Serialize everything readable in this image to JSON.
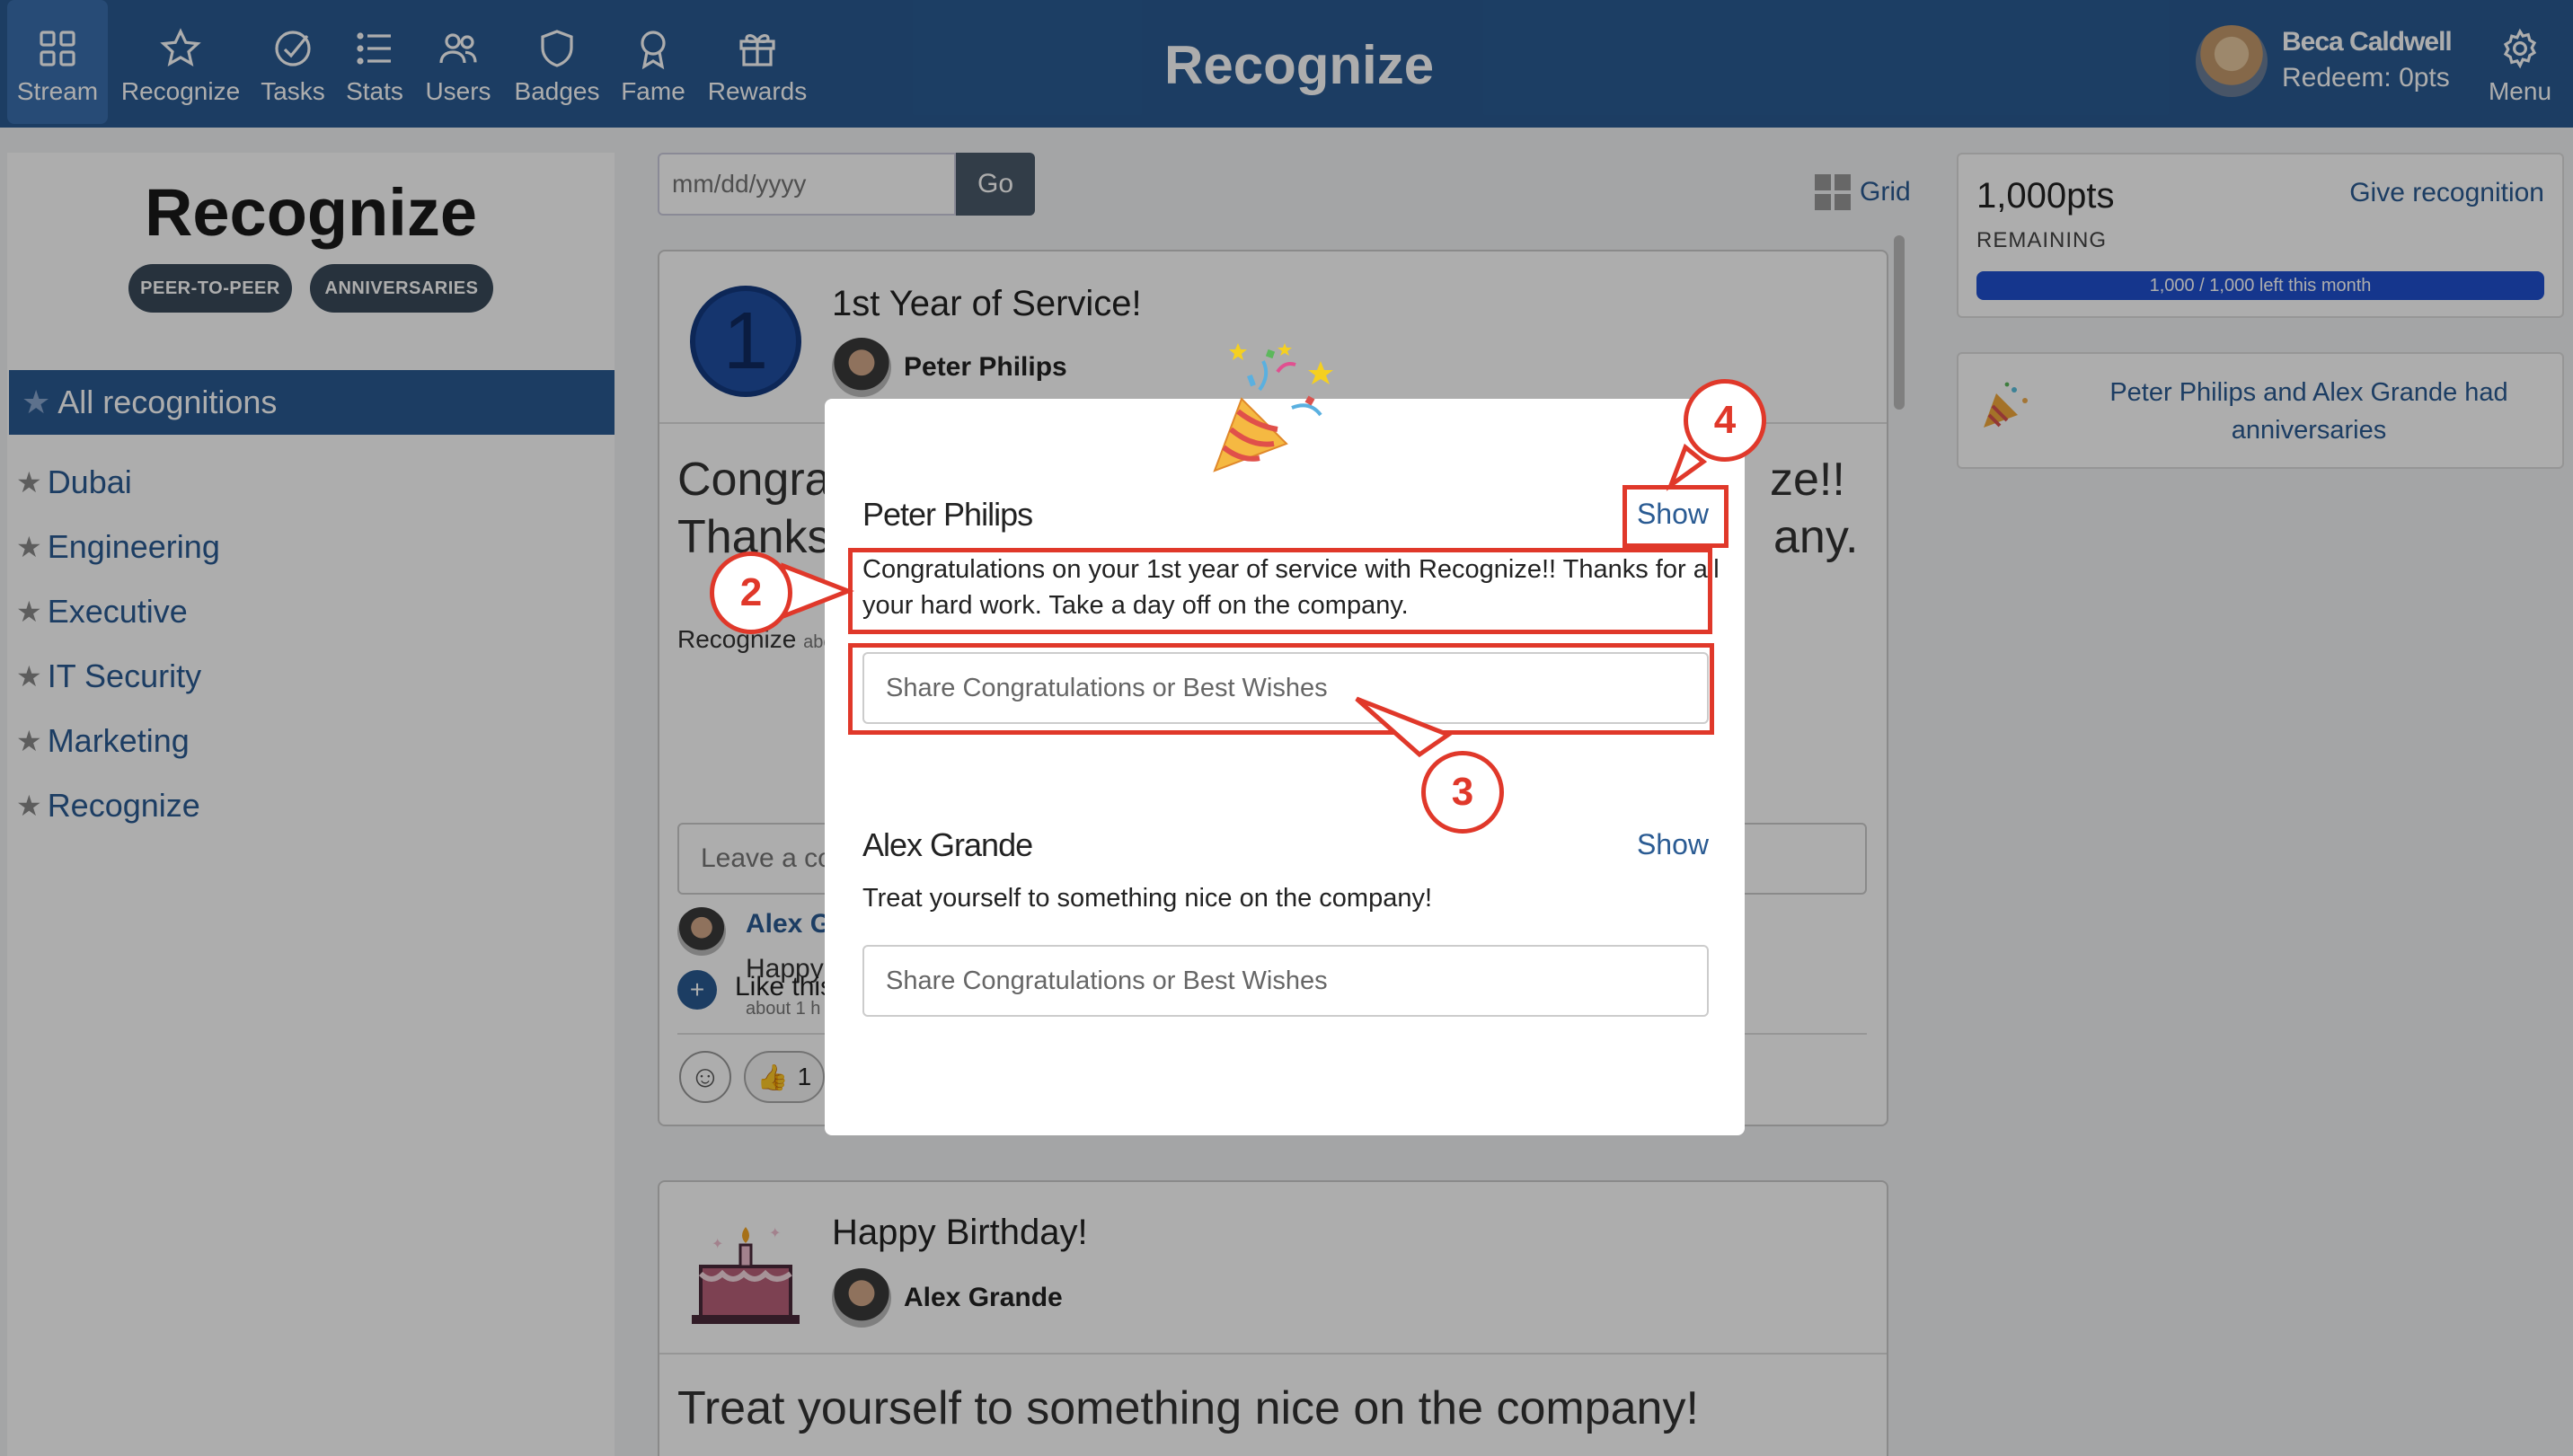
{
  "nav": {
    "items": [
      {
        "label": "Stream",
        "icon": "grid-icon"
      },
      {
        "label": "Recognize",
        "icon": "star-icon"
      },
      {
        "label": "Tasks",
        "icon": "check-circle-icon"
      },
      {
        "label": "Stats",
        "icon": "list-icon"
      },
      {
        "label": "Users",
        "icon": "users-icon"
      },
      {
        "label": "Badges",
        "icon": "shield-icon"
      },
      {
        "label": "Fame",
        "icon": "award-icon"
      },
      {
        "label": "Rewards",
        "icon": "gift-icon"
      }
    ],
    "brand": "Recognize",
    "user_name": "Beca Caldwell",
    "redeem": "Redeem: 0pts",
    "menu_label": "Menu"
  },
  "sidebar": {
    "title": "Recognize",
    "pills": [
      "PEER-TO-PEER",
      "ANNIVERSARIES"
    ],
    "active": "All recognitions",
    "links": [
      "Dubai",
      "Engineering",
      "Executive",
      "IT Security",
      "Marketing",
      "Recognize"
    ]
  },
  "search": {
    "date_placeholder": "mm/dd/yyyy",
    "go_label": "Go",
    "grid_label": "Grid"
  },
  "feed": {
    "card1": {
      "badge_number": "1",
      "title": "1st Year of Service!",
      "person": "Peter Philips",
      "body_line1_left": "Congrat",
      "body_line1_right": "ze!!",
      "body_line2_left": "Thanks",
      "body_line2_right": "any.",
      "source": "Recognize",
      "source_time": "abo",
      "comment_placeholder": "Leave a con",
      "commenter": "Alex G",
      "comment_text": "Happy",
      "comment_time": "about 1 h",
      "like_label": "Like this",
      "thumb_count": "1"
    },
    "card2": {
      "title": "Happy Birthday!",
      "person": "Alex Grande",
      "body": "Treat yourself to something nice on the company!"
    }
  },
  "right": {
    "points": "1,000pts",
    "remaining": "REMAINING",
    "give_label": "Give recognition",
    "bar_text": "1,000 / 1,000 left this month",
    "bar_fraction": 1.0,
    "anniversary_text": "Peter Philips and Alex Grande had anniversaries"
  },
  "modal": {
    "entries": [
      {
        "name": "Peter Philips",
        "show_label": "Show",
        "message": "Congratulations on your 1st year of service with Recognize!! Thanks for all your hard work. Take a day off on the company.",
        "input_placeholder": "Share Congratulations or Best Wishes"
      },
      {
        "name": "Alex Grande",
        "show_label": "Show",
        "message": "Treat yourself to something nice on the company!",
        "input_placeholder": "Share Congratulations or Best Wishes"
      }
    ]
  },
  "annotations": {
    "callout_2": "2",
    "callout_3": "3",
    "callout_4": "4",
    "color": "#e0382a"
  },
  "colors": {
    "nav_bg": "#2a5b93",
    "link": "#2a5b93",
    "progress": "#1f50d0"
  }
}
